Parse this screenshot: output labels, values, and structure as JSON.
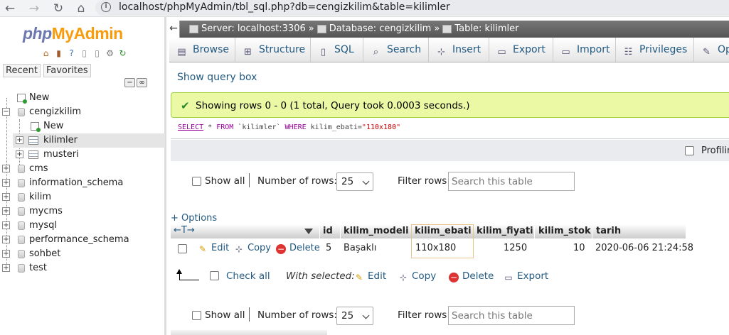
{
  "browser": {
    "back": "←",
    "forward": "→",
    "reload": "↻",
    "home": "⌂",
    "url": "localhost/phpMyAdmin/tbl_sql.php?db=cengizkilim&table=kilimler"
  },
  "logo": {
    "php": "php",
    "my": "My",
    "admin": "Admin"
  },
  "left_tabs": {
    "recent": "Recent",
    "favorites": "Favorites"
  },
  "tree": {
    "new_root": "New",
    "db_current": "cengizkilim",
    "db_new": "New",
    "tables": [
      "kilimler",
      "musteri"
    ],
    "databases": [
      "cms",
      "information_schema",
      "kilim",
      "mycms",
      "mysql",
      "performance_schema",
      "sohbet",
      "test"
    ]
  },
  "breadcrumb": {
    "server": "Server: localhost:3306",
    "database": "Database: cengizkilim",
    "table": "Table: kilimler",
    "sep": "»"
  },
  "menu": [
    "Browse",
    "Structure",
    "SQL",
    "Search",
    "Insert",
    "Export",
    "Import",
    "Privileges",
    "Op"
  ],
  "show_query_box": "Show query box",
  "success_msg": "Showing rows 0 - 0 (1 total, Query took 0.0003 seconds.)",
  "sql": {
    "select": "SELECT",
    "rest1": " * ",
    "from": "FROM",
    "table": " `kilimler` ",
    "where": "WHERE",
    "cond": " kilim_ebati=",
    "value": "\"110x180\""
  },
  "profiling": "Profilin",
  "nav": {
    "show_all": "Show all",
    "num_rows_label": "Number of rows:",
    "num_rows_value": "25",
    "filter_label": "Filter rows:",
    "filter_placeholder": "Search this table"
  },
  "options": "+ Options",
  "table": {
    "sort_arrows": "←T→",
    "columns": [
      "id",
      "kilim_modeli",
      "kilim_ebati",
      "kilim_fiyati",
      "kilim_stok",
      "tarih"
    ],
    "row": {
      "edit": "Edit",
      "copy": "Copy",
      "delete": "Delete",
      "id": "5",
      "kilim_modeli": "Başaklı",
      "kilim_ebati": "110x180",
      "kilim_fiyati": "1250",
      "kilim_stok": "10",
      "tarih": "2020-06-06 21:24:58"
    }
  },
  "bulk": {
    "check_all": "Check all",
    "with_selected": "With selected:",
    "edit": "Edit",
    "copy": "Copy",
    "delete": "Delete",
    "export": "Export"
  },
  "colors": {
    "link": "#235a81",
    "success_bg": "#ebf8a4",
    "accent": "#f89c0e"
  }
}
